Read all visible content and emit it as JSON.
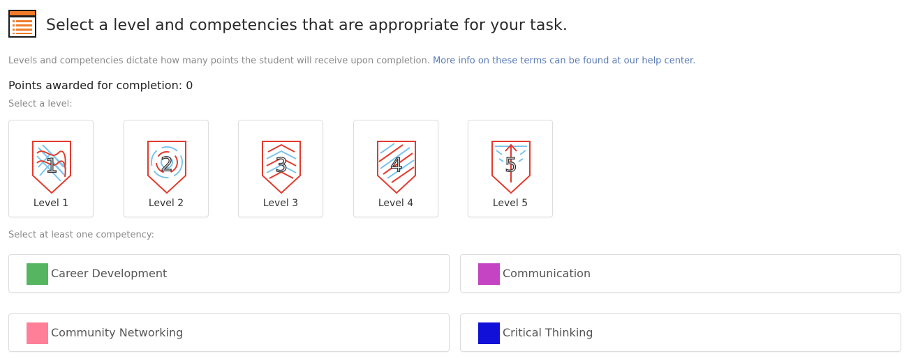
{
  "header": {
    "icon": "list-document-icon",
    "title": "Select a level and competencies that are appropriate for your task."
  },
  "description": {
    "text": "Levels and competencies dictate how many points the student will receive upon completion. ",
    "link": "More info on these terms can be found at our help center."
  },
  "points": {
    "label": "Points awarded for completion: 0"
  },
  "levels": {
    "prompt": "Select a level:",
    "items": [
      {
        "label": "Level 1",
        "badge": "1"
      },
      {
        "label": "Level 2",
        "badge": "2"
      },
      {
        "label": "Level 3",
        "badge": "3"
      },
      {
        "label": "Level 4",
        "badge": "4"
      },
      {
        "label": "Level 5",
        "badge": "5"
      }
    ]
  },
  "competencies": {
    "prompt": "Select at least one competency:",
    "items": [
      {
        "label": "Career Development",
        "color": "#55b561"
      },
      {
        "label": "Communication",
        "color": "#c444c4"
      },
      {
        "label": "Community Networking",
        "color": "#ff7f99"
      },
      {
        "label": "Critical Thinking",
        "color": "#1010d8"
      }
    ]
  },
  "colors": {
    "accent_red": "#e23b2e",
    "accent_blue": "#7cc4ef",
    "header_orange": "#f07c2a"
  }
}
